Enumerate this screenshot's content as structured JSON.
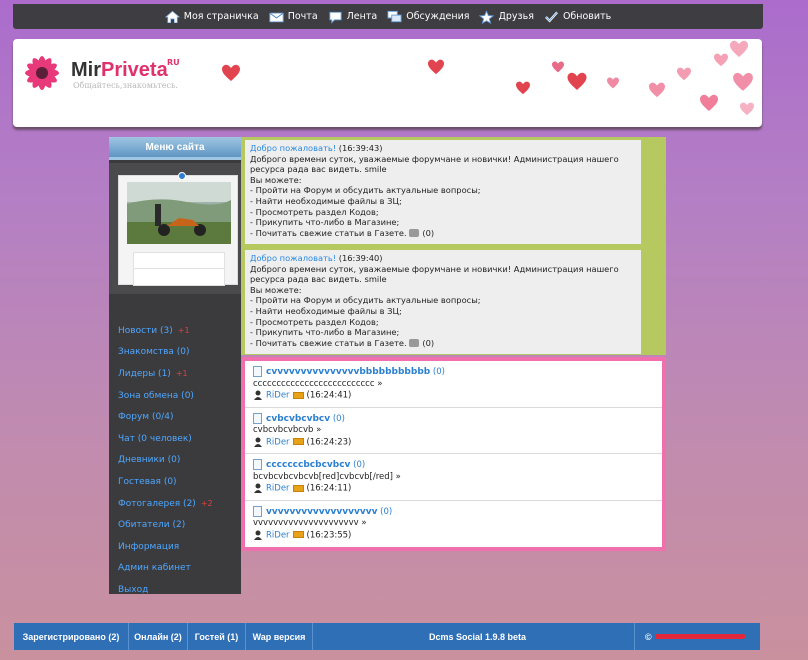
{
  "nav": [
    {
      "label": "Моя страничка",
      "icon": "home-icon"
    },
    {
      "label": "Почта",
      "icon": "mail-icon"
    },
    {
      "label": "Лента",
      "icon": "chat-bubble-icon"
    },
    {
      "label": "Обсуждения",
      "icon": "discussion-icon"
    },
    {
      "label": "Друзья",
      "icon": "star-icon"
    },
    {
      "label": "Обновить",
      "icon": "check-icon"
    }
  ],
  "logo": {
    "name_part1": "Mir",
    "name_part2": "Priveta",
    "tld": "RU",
    "slogan": "Общайтесь,знакомьтесь."
  },
  "sidebar": {
    "title": "Меню сайта",
    "items": [
      {
        "label": "Новости (3)",
        "badge": "+1"
      },
      {
        "label": "Знакомства (0)",
        "badge": ""
      },
      {
        "label": "Лидеры (1)",
        "badge": "+1"
      },
      {
        "label": "Зона обмена (0)",
        "badge": ""
      },
      {
        "label": "Форум (0/4)",
        "badge": ""
      },
      {
        "label": "Чат (0 человек)",
        "badge": ""
      },
      {
        "label": "Дневники (0)",
        "badge": ""
      },
      {
        "label": "Гостевая (0)",
        "badge": ""
      },
      {
        "label": "Фотогалерея (2)",
        "badge": "+2"
      },
      {
        "label": "Обитатели (2)",
        "badge": ""
      },
      {
        "label": "Информация",
        "badge": ""
      },
      {
        "label": "Админ кабинет",
        "badge": ""
      },
      {
        "label": "Выход",
        "badge": ""
      }
    ]
  },
  "welcome_posts": [
    {
      "title": "Добро пожаловать!",
      "time": "(16:39:43)",
      "lines": [
        "Доброго времени суток, уважаемые форумчане и новички! Администрация нашего ресурса рада вас видеть. smile",
        "Вы можете:",
        "- Пройти на Форум и обсудить актуальные вопросы;",
        "- Найти необходимые файлы в ЗЦ;",
        "- Просмотреть раздел Кодов;",
        "- Прикупить что-либо в Магазине;"
      ],
      "last_line": "- Почитать свежие статьи в Газете.",
      "comments": "(0)"
    },
    {
      "title": "Добро пожаловать!",
      "time": "(16:39:40)",
      "lines": [
        "Доброго времени суток, уважаемые форумчане и новички! Администрация нашего ресурса рада вас видеть. smile",
        "Вы можете:",
        "- Пройти на Форум и обсудить актуальные вопросы;",
        "- Найти необходимые файлы в ЗЦ;",
        "- Просмотреть раздел Кодов;",
        "- Прикупить что-либо в Магазине;"
      ],
      "last_line": "- Почитать свежие статьи в Газете.",
      "comments": "(0)"
    }
  ],
  "topics": [
    {
      "title": "cvvvvvvvvvvvvvvvbbbbbbbbbbb",
      "count": "(0)",
      "excerpt": "cccccccccccccccccccccccccc »",
      "author": "RiDer",
      "time": "(16:24:41)"
    },
    {
      "title": "cvbcvbcvbcv",
      "count": "(0)",
      "excerpt": "cvbcvbcvbcvb »",
      "author": "RiDer",
      "time": "(16:24:23)"
    },
    {
      "title": "cccccccbcbcvbcv",
      "count": "(0)",
      "excerpt": "bcvbcvbcvbcvb[red]cvbcvb[/red] »",
      "author": "RiDer",
      "time": "(16:24:11)"
    },
    {
      "title": "vvvvvvvvvvvvvvvvvvv",
      "count": "(0)",
      "excerpt": "vvvvvvvvvvvvvvvvvvvvv »",
      "author": "RiDer",
      "time": "(16:23:55)"
    }
  ],
  "footer": {
    "registered": "Зарегистрировано (2)",
    "online": "Онлайн (2)",
    "guests": "Гостей (1)",
    "wap": "Wap версия",
    "version": "Dcms Social 1.9.8 beta",
    "copyright": "©"
  },
  "colors": {
    "accent_pink": "#f06fad",
    "green": "#b5c960",
    "footer_blue": "#2f6fb6",
    "link_blue": "#2a7fd0"
  }
}
